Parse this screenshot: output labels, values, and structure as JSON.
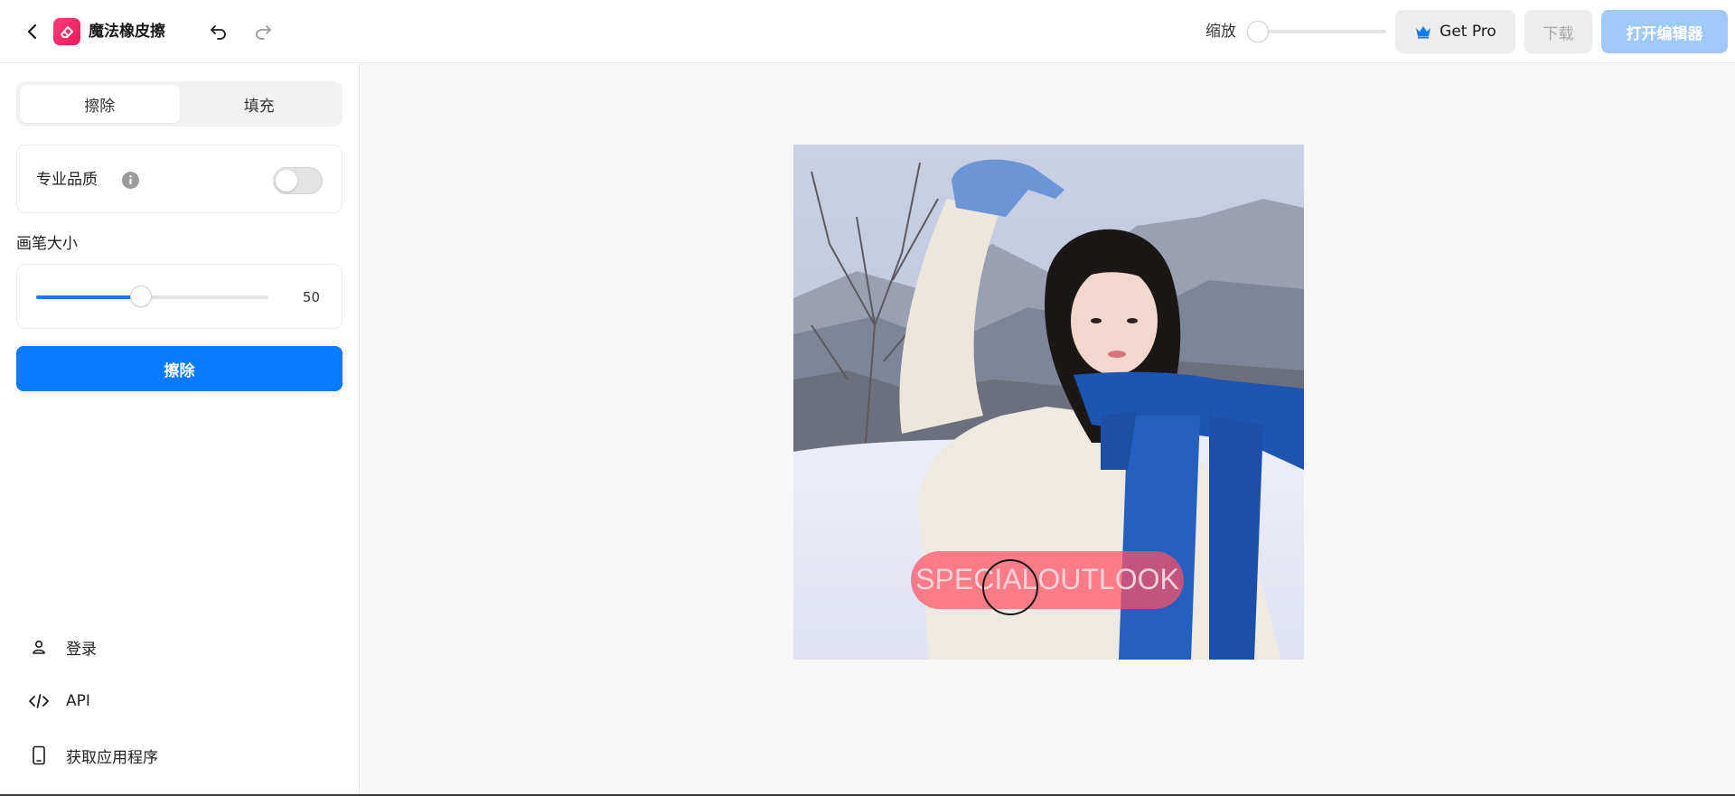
{
  "header": {
    "app_title": "魔法橡皮擦",
    "zoom_label": "缩放",
    "zoom_level": 0,
    "get_pro_label": "Get Pro",
    "download_label": "下载",
    "open_editor_label": "打开编辑器"
  },
  "sidebar": {
    "tabs": [
      {
        "label": "擦除",
        "active": true
      },
      {
        "label": "填充",
        "active": false
      }
    ],
    "pro_quality_label": "专业品质",
    "pro_quality_enabled": false,
    "brush_size_label": "画笔大小",
    "brush_size_value": "50",
    "brush_size_fraction": 0.45,
    "erase_button_label": "擦除",
    "links": [
      {
        "label": "登录",
        "icon": "user-icon"
      },
      {
        "label": "API",
        "icon": "code-icon"
      },
      {
        "label": "获取应用程序",
        "icon": "phone-icon"
      }
    ]
  },
  "canvas": {
    "watermark_text": "SPECIALOUTLOOK",
    "photo_description_icon": "photo-canvas"
  },
  "colors": {
    "accent": "#0a7bff",
    "accent_disabled": "#9fc9f9",
    "logo": "#e8195a",
    "mask_overlay": "#ff5064"
  }
}
